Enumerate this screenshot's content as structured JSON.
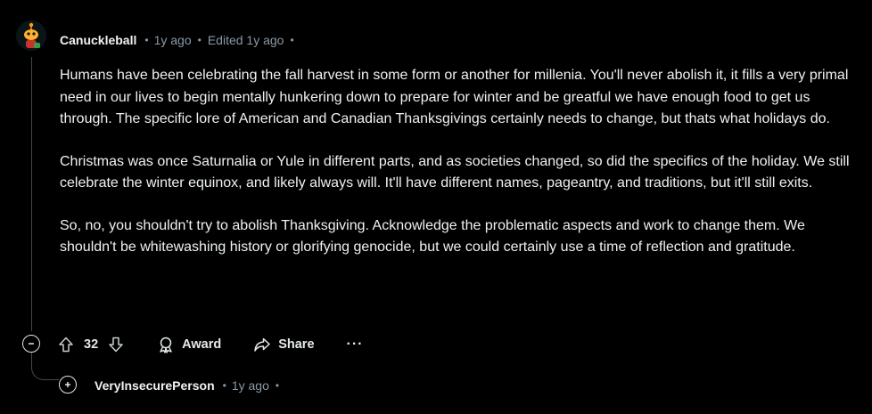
{
  "comment": {
    "author": "Canuckleball",
    "time": "1y ago",
    "edited": "Edited 1y ago",
    "paragraphs": [
      "Humans have been celebrating the fall harvest in some form or another for millenia. You'll never abolish it, it fills a very primal need in our lives to begin mentally hunkering down to prepare for winter and be greatful we have enough food to get us through. The specific lore of American and Canadian Thanksgivings certainly needs to change, but thats what holidays do.",
      "Christmas was once Saturnalia or Yule in different parts, and as societies changed, so did the specifics of the holiday. We still celebrate the winter equinox, and likely always will. It'll have different names, pageantry, and traditions, but it'll still exits.",
      "So, no, you shouldn't try to abolish Thanksgiving. Acknowledge the problematic aspects and work to change them. We shouldn't be whitewashing history or glorifying genocide, but we could certainly use a time of reflection and gratitude."
    ],
    "votes": "32",
    "award_label": "Award",
    "share_label": "Share",
    "more_label": "···"
  },
  "reply": {
    "author": "VeryInsecurePerson",
    "time": "1y ago"
  },
  "icons": {
    "avatar": "snoo-avatar-icon",
    "upvote": "arrow-up-icon",
    "downvote": "arrow-down-icon",
    "award": "award-icon",
    "share": "share-icon",
    "collapse": "minus-circle-icon",
    "expand": "plus-circle-icon"
  },
  "colors": {
    "background": "#000000",
    "text": "#f2f2f2",
    "muted": "#8a9aa6",
    "thread_line": "#3e4a52",
    "avatar_accent": "#ff9b1f"
  }
}
